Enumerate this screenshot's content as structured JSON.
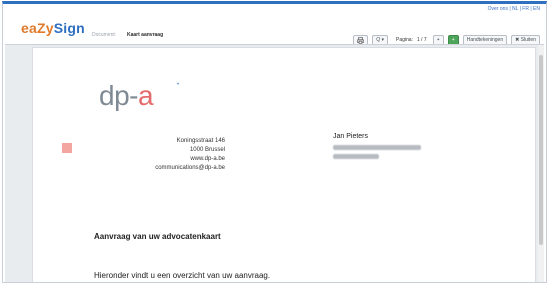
{
  "header": {
    "top_links": "Over ons  |  NL  |  FR  |  EN",
    "logo_part1": "eaZy",
    "logo_part2": "Sign",
    "doc_label": "Document:",
    "doc_name": "Kaart aanvraag"
  },
  "toolbar": {
    "print_icon": "print-icon",
    "zoom_label": "Q ▾",
    "page_label": "Pagina:",
    "page_value": "1 / 7",
    "add_label": "+",
    "green_label": "+",
    "handtekeningen_label": "Handtekeningen",
    "sluiten_label": "✖ Sluiten"
  },
  "document": {
    "logo_text_dp": "dp-",
    "logo_text_a": "a",
    "address": {
      "line1": "Koningsstraat 146",
      "line2": "1000 Brussel",
      "line3": "www.dp-a.be",
      "line4": "communications@dp-a.be"
    },
    "recipient": {
      "name": "Jan Pieters"
    },
    "title": "Aanvraag van uw advocatenkaart",
    "body": "Hieronder vindt u een overzicht van uw aanvraag."
  },
  "colors": {
    "accent_blue": "#2f6fc0",
    "accent_orange": "#e07a2a",
    "dpa_red": "#e46b6b",
    "green_button": "#4da45a"
  }
}
